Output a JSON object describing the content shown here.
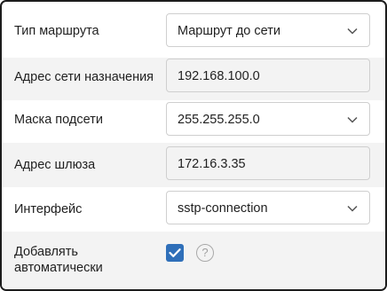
{
  "route_form": {
    "route_type": {
      "label": "Тип маршрута",
      "value": "Маршрут до сети"
    },
    "destination": {
      "label": "Адрес сети назначения",
      "value": "192.168.100.0"
    },
    "subnet_mask": {
      "label": "Маска подсети",
      "value": "255.255.255.0"
    },
    "gateway": {
      "label": "Адрес шлюза",
      "value": "172.16.3.35"
    },
    "interface": {
      "label": "Интерфейс",
      "value": "sstp-connection"
    },
    "auto_add": {
      "label_line1": "Добавлять",
      "label_line2": "автоматически",
      "checked": true,
      "help_glyph": "?"
    }
  },
  "colors": {
    "accent": "#2f6fb9",
    "row_shade": "#f3f3f3",
    "border": "#cfcfcf"
  }
}
